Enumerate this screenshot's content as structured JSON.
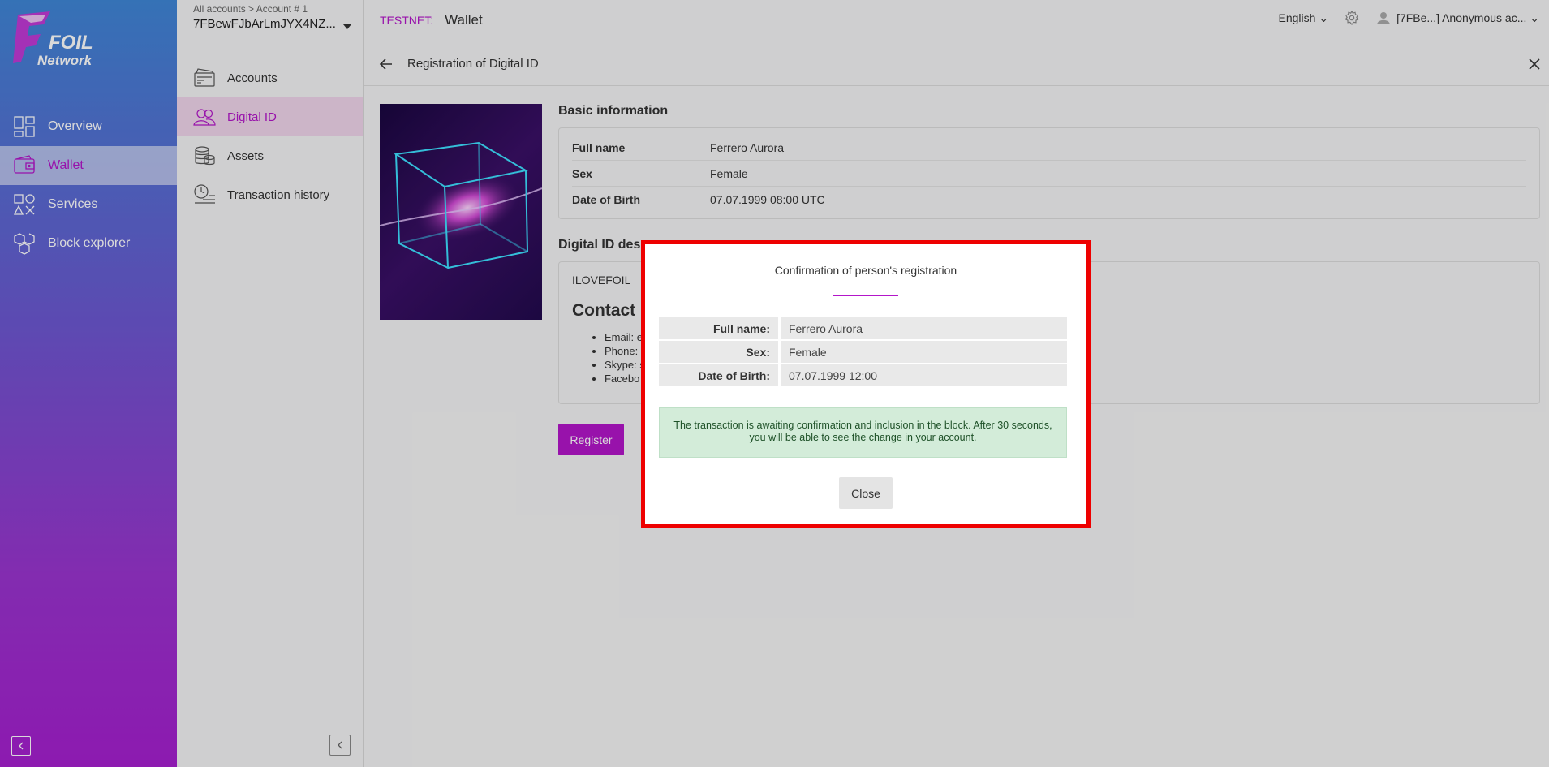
{
  "logo": {
    "line1": "FOIL",
    "line2": "Network"
  },
  "sidebar": {
    "items": [
      {
        "label": "Overview",
        "icon": "dashboard-icon"
      },
      {
        "label": "Wallet",
        "icon": "wallet-icon",
        "active": true
      },
      {
        "label": "Services",
        "icon": "services-icon"
      },
      {
        "label": "Block explorer",
        "icon": "blocks-icon"
      }
    ]
  },
  "account": {
    "breadcrumb": "All accounts > Account # 1",
    "number": "7FBewFJbArLmJYX4NZ...",
    "nav": [
      {
        "label": "Accounts",
        "icon": "card-icon"
      },
      {
        "label": "Digital ID",
        "icon": "people-icon",
        "active": true
      },
      {
        "label": "Assets",
        "icon": "coins-icon"
      },
      {
        "label": "Transaction history",
        "icon": "history-icon"
      }
    ]
  },
  "topbar": {
    "network": "TESTNET:",
    "title": "Wallet",
    "language": "English",
    "user": "[7FBe...] Anonymous ac..."
  },
  "page": {
    "title": "Registration of Digital ID",
    "basic_title": "Basic information",
    "basic": [
      {
        "key": "Full name",
        "value": "Ferrero Aurora"
      },
      {
        "key": "Sex",
        "value": "Female"
      },
      {
        "key": "Date of Birth",
        "value": "07.07.1999 08:00 UTC"
      }
    ],
    "desc_title": "Digital ID desc",
    "desc_text": "ILOVEFOIL",
    "desc_heading": "Contact I",
    "desc_items": [
      "Email: e",
      "Phone:",
      "Skype: s",
      "Facebo"
    ],
    "register_label": "Register"
  },
  "modal": {
    "title": "Confirmation of person's registration",
    "rows": [
      {
        "key": "Full name:",
        "value": "Ferrero Aurora"
      },
      {
        "key": "Sex:",
        "value": "Female"
      },
      {
        "key": "Date of Birth:",
        "value": "07.07.1999 12:00"
      }
    ],
    "alert": "The transaction is awaiting confirmation and inclusion in the block. After 30 seconds, you will be able to see the change in your account.",
    "close_label": "Close"
  },
  "colors": {
    "accent": "#b316c9",
    "highlight_border": "#ee0000",
    "success_bg": "#d3ecd9"
  }
}
